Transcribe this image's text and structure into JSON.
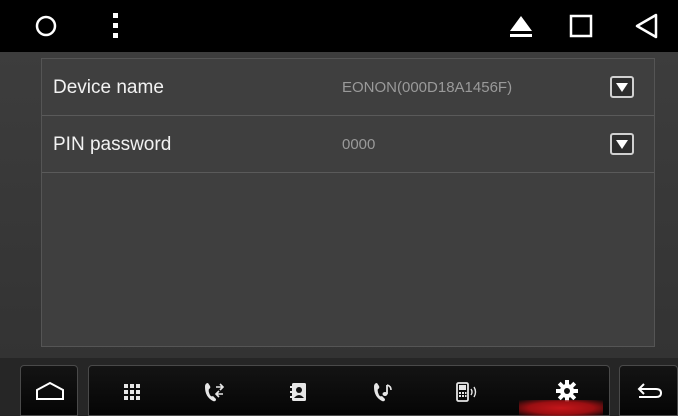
{
  "statusbar": {
    "icons": [
      "home-circle-icon",
      "menu-dots-icon",
      "eject-icon",
      "recent-apps-icon",
      "back-triangle-icon"
    ]
  },
  "settings": {
    "rows": [
      {
        "label": "Device name",
        "value": "EONON(000D18A1456F)"
      },
      {
        "label": "PIN password",
        "value": "0000"
      }
    ]
  },
  "dock": {
    "tabs": [
      "dialpad-icon",
      "call-transfer-icon",
      "contacts-icon",
      "call-log-icon",
      "phone-audio-icon",
      "settings-gear-icon"
    ],
    "active_tab": "settings-gear-icon",
    "active_color": "#c4161a"
  }
}
